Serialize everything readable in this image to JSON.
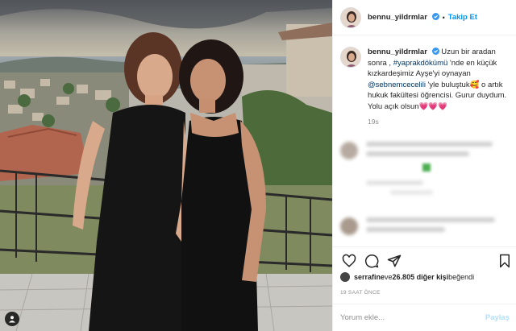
{
  "post": {
    "username": "bennu_yildrmlar",
    "follow_label": "Takip Et",
    "separator": "•",
    "caption": {
      "username": "bennu_yildrmlar",
      "part1": "Uzun bir aradan sonra , ",
      "hashtag": "#yaprakdökümü",
      "part2": " 'nde en küçük kızkardeşimiz Ayşe'yi oynayan ",
      "mention": "@sebnemcecelili",
      "part3": " 'yle buluştuk",
      "emoji1": "🥰",
      "part4": " o artık hukuk fakültesi öğrencisi. Gurur duydum. Yolu açık olsun",
      "emoji2": "💗💗💗"
    },
    "caption_time": "19s",
    "likes": {
      "liker": "serrafine",
      "middle": " ve ",
      "count": "26.805 diğer kişi",
      "suffix": " beğendi"
    },
    "post_time": "19 SAAT ÖNCE",
    "comment_placeholder": "Yorum ekle...",
    "post_label": "Paylaş"
  },
  "icons": {
    "verified": "verified-badge-icon",
    "like": "heart-icon",
    "comment": "comment-bubble-icon",
    "share": "paper-plane-icon",
    "save": "bookmark-icon",
    "tag": "user-tag-icon"
  },
  "colors": {
    "accent": "#0095f6",
    "link": "#00376b",
    "muted": "#8e8e8e",
    "border": "#efefef"
  }
}
